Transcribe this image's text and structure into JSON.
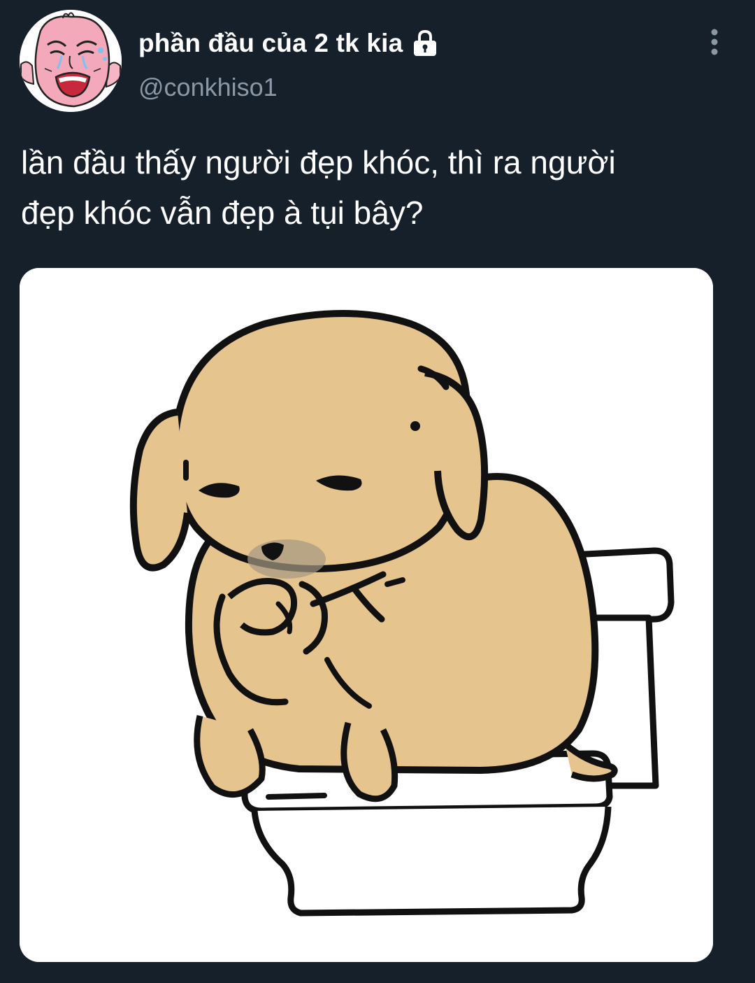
{
  "tweet": {
    "display_name": "phần đầu của 2 tk kia",
    "handle": "@conkhiso1",
    "text": "lần đầu thấy người đẹp khóc, thì ra người\nđẹp khóc vẫn đẹp à tụi bây?",
    "avatar_icon": "crying-cartoon-face-avatar",
    "lock_icon": "lock-icon",
    "more_icon": "more-vertical-icon",
    "media_icon": "crying-puppy-on-toilet-illustration"
  },
  "colors": {
    "background": "#15202b",
    "text_primary": "#ffffff",
    "text_secondary": "#8b98a5",
    "puppy_fur": "#e6c48d"
  }
}
